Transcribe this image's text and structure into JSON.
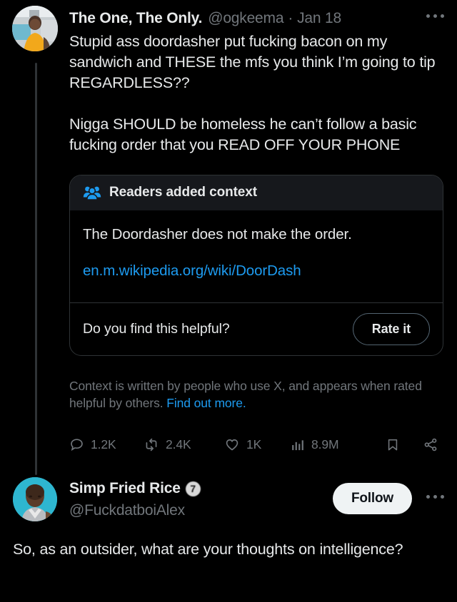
{
  "theme": {
    "background": "#000000",
    "text_primary": "#e7e9ea",
    "text_muted": "#71767b",
    "accent_blue": "#1d9bf0",
    "note_header_bg": "#16181c",
    "border": "#2f3336",
    "follow_button_bg": "#eff3f4"
  },
  "tweet1": {
    "display_name": "The One, The Only.",
    "handle": "@ogkeema",
    "separator": "·",
    "date": "Jan 18",
    "more_icon": "more-horizontal-icon",
    "avatar_alt": "avatar",
    "paragraph1": "Stupid ass doordasher put fucking bacon on my sandwich and THESE the mfs you think I’m going to tip REGARDLESS??",
    "paragraph2": "Nigga SHOULD be homeless he can’t follow a basic fucking order that you READ OFF YOUR PHONE",
    "community_note": {
      "header_icon": "people-group-icon",
      "header_title": "Readers added context",
      "body_text": "The Doordasher does not make the order.",
      "link_text": "en.m.wikipedia.org/wiki/DoorDash",
      "footer_question": "Do you find this helpful?",
      "rate_button": "Rate it"
    },
    "disclaimer": {
      "text": "Context is written by people who use X, and appears when rated helpful by others. ",
      "link_text": "Find out more."
    },
    "actions": {
      "reply": {
        "icon": "reply-icon",
        "count": "1.2K"
      },
      "repost": {
        "icon": "repost-icon",
        "count": "2.4K"
      },
      "like": {
        "icon": "heart-icon",
        "count": "1K"
      },
      "views": {
        "icon": "analytics-icon",
        "count": "8.9M"
      },
      "bookmark": {
        "icon": "bookmark-icon",
        "count": ""
      },
      "share": {
        "icon": "share-icon",
        "count": ""
      }
    }
  },
  "tweet2": {
    "display_name": "Simp Fried Rice",
    "verified_badge": "verified-badge-icon",
    "verified_glyph": "7",
    "handle": "@FuckdatboiAlex",
    "follow_button": "Follow",
    "more_icon": "more-horizontal-icon",
    "avatar_alt": "avatar",
    "body": "So, as an outsider, what are your thoughts on intelligence?"
  }
}
